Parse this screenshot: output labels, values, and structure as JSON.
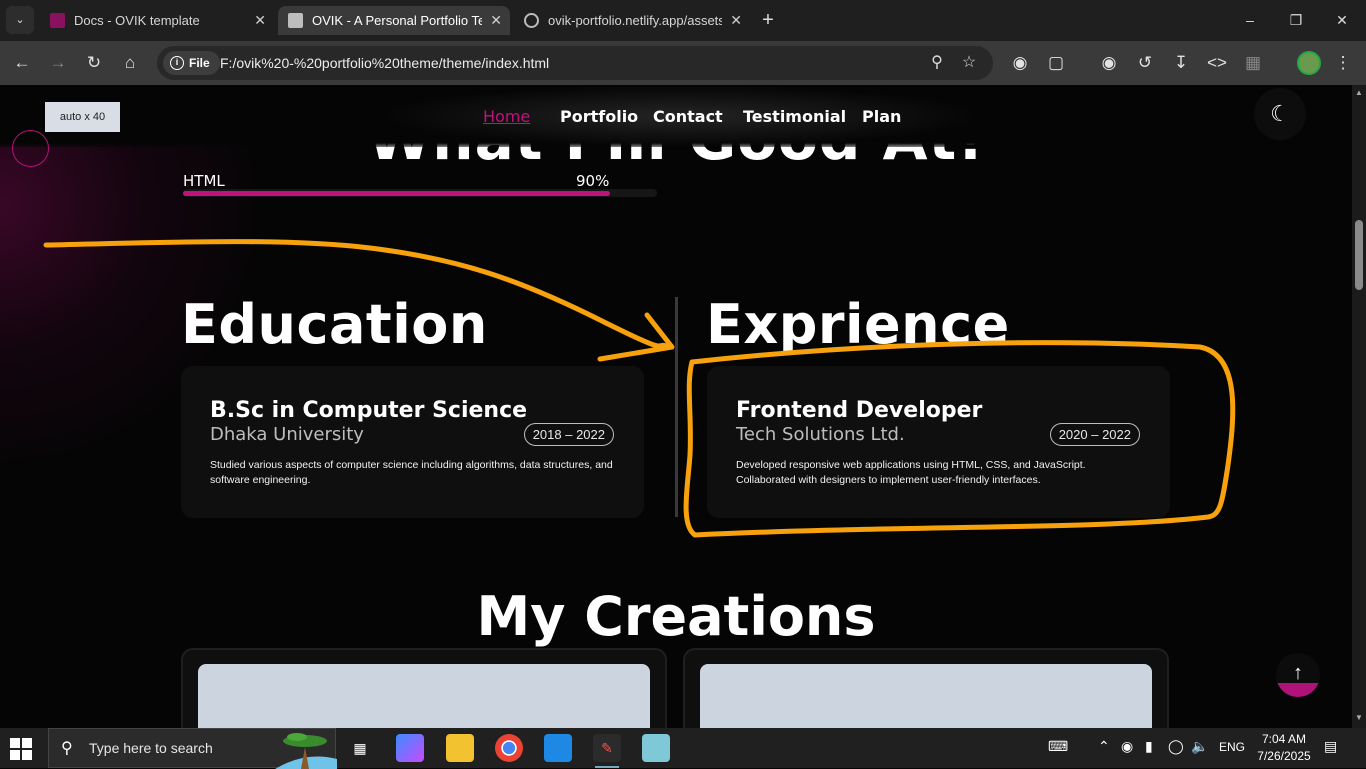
{
  "browser": {
    "tabs": [
      {
        "title": "Docs - OVIK template"
      },
      {
        "title": "OVIK - A Personal Portfolio Tem"
      },
      {
        "title": "ovik-portfolio.netlify.app/assets"
      }
    ],
    "address": {
      "chip": "File",
      "url": "F:/ovik%20-%20portfolio%20theme/theme/index.html"
    }
  },
  "page": {
    "size_tooltip": "auto x 40",
    "nav": [
      "Home",
      "Portfolio",
      "Contact",
      "Testimonial",
      "Plan"
    ],
    "skills_heading": "What I'm Good At!",
    "skill": {
      "label": "HTML",
      "percent_text": "90%",
      "percent": 90
    },
    "education": {
      "title": "Education",
      "card": {
        "role": "B.Sc in Computer Science",
        "org": "Dhaka University",
        "date": "2018 – 2022",
        "desc": "Studied various aspects of computer science including algorithms, data structures, and software engineering."
      }
    },
    "experience": {
      "title": "Exprience",
      "card": {
        "role": "Frontend Developer",
        "org": "Tech Solutions Ltd.",
        "date": "2020 – 2022",
        "desc": "Developed responsive web applications using HTML, CSS, and JavaScript. Collaborated with designers to implement user-friendly interfaces."
      }
    },
    "creations_title": "My Creations"
  },
  "annotation": {
    "color": "#f7a20c"
  },
  "colors": {
    "accent": "#c0127d",
    "background": "#060506",
    "card": "#0f0f0f"
  },
  "taskbar": {
    "search_placeholder": "Type here to search",
    "language": "ENG",
    "time": "7:04 AM",
    "date": "7/26/2025"
  }
}
